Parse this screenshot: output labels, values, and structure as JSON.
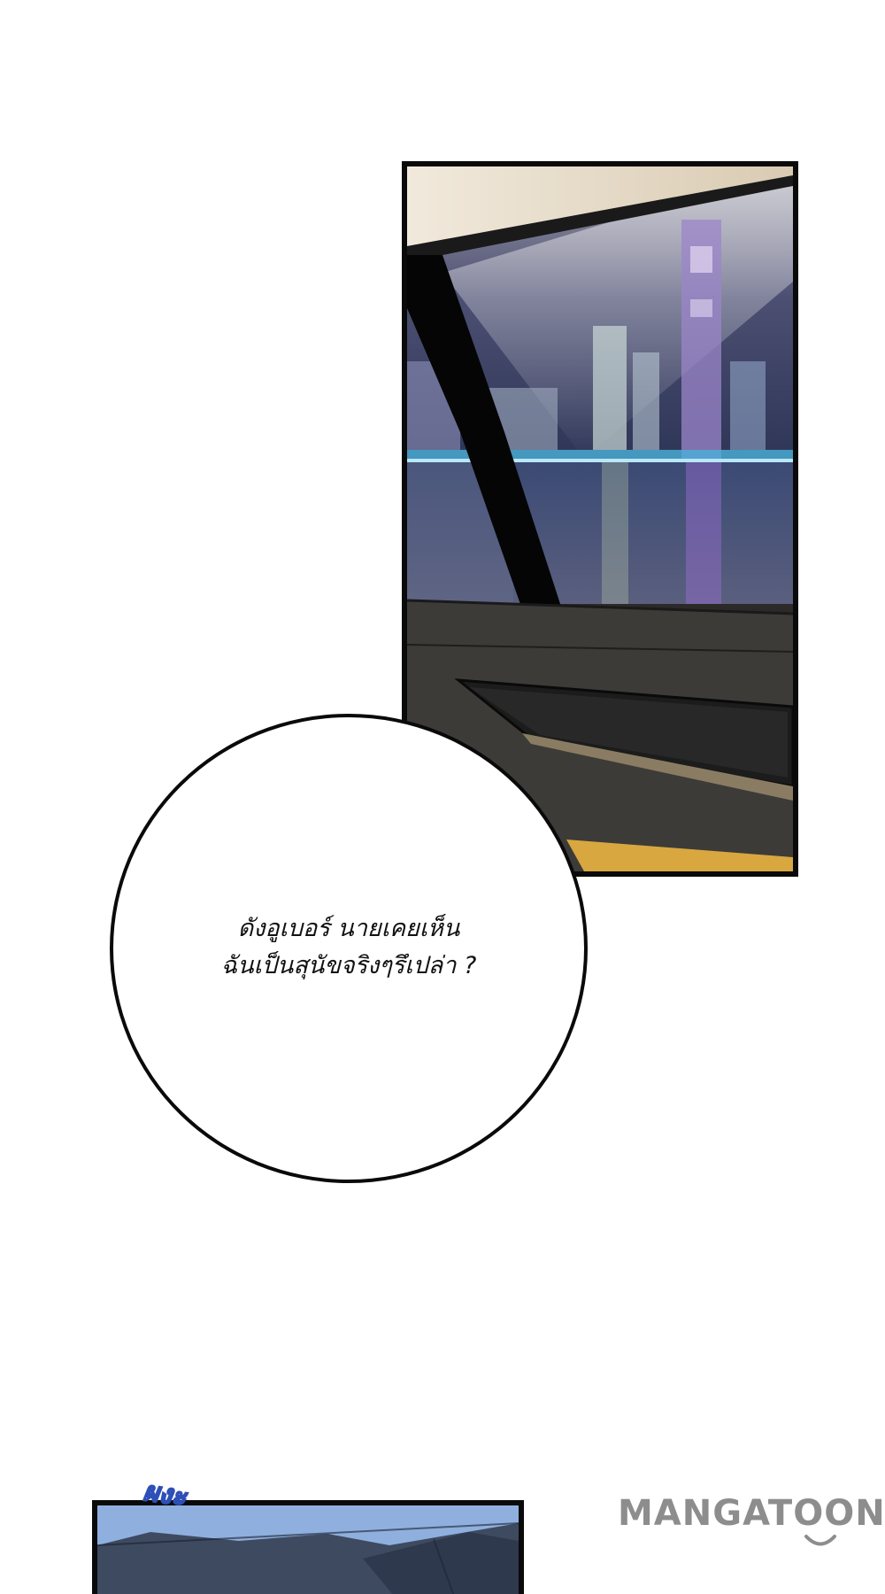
{
  "speech_bubble": {
    "lines": [
      "ดังอูเบอร์ นายเคยเห็น",
      "ฉันเป็นสุนัขจริงๆรึเปล่า ?"
    ]
  },
  "sound_effect": {
    "text": "ผงะ"
  },
  "watermark": {
    "text": "MANGATOON"
  },
  "colors": {
    "background": "#ffffff",
    "panel_border": "#0a0a0a",
    "watermark": "#8d8d8d",
    "sfx_outline": "#2e4fb8",
    "sky_blue": "#7fa2d6"
  }
}
